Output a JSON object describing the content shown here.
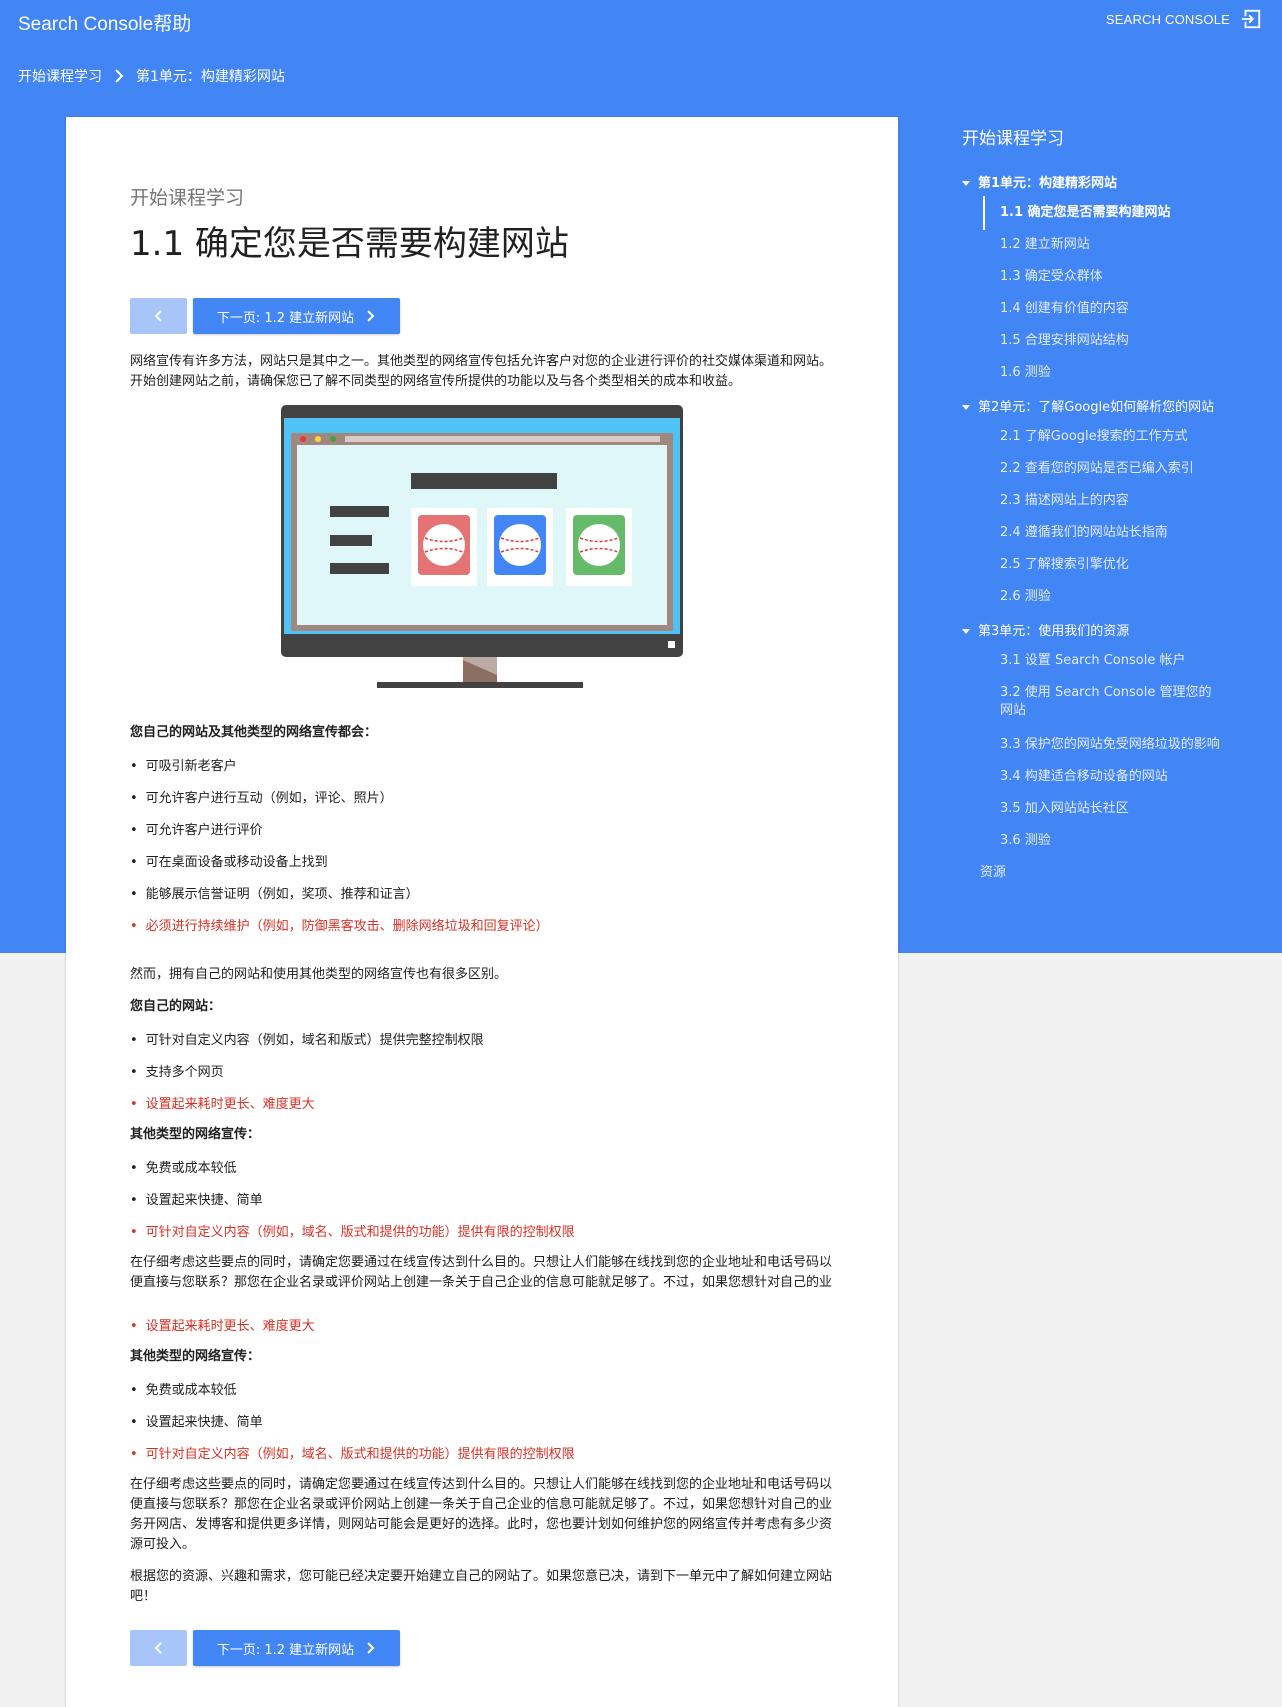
{
  "header": {
    "app_title": "Search Console帮助",
    "sc_link": "SEARCH CONSOLE"
  },
  "breadcrumb": {
    "root": "开始课程学习",
    "current": "第1单元：构建精彩网站"
  },
  "article": {
    "eyebrow": "开始课程学习",
    "title": "1.1 确定您是否需要构建网站",
    "next_label": "下一页: 1.2 建立新网站",
    "intro": "网络宣传有许多方法，网站只是其中之一。其他类型的网络宣传包括允许客户对您的企业进行评价的社交媒体渠道和网站。开始创建网站之前，请确保您已了解不同类型的网络宣传所提供的功能以及与各个类型相关的成本和收益。",
    "both_heading": "您自己的网站及其他类型的网络宣传都会：",
    "both_items": [
      "可吸引新老客户",
      "可允许客户进行互动（例如，评论、照片）",
      "可允许客户进行评价",
      "可在桌面设备或移动设备上找到",
      "能够展示信誉证明（例如，奖项、推荐和证言）"
    ],
    "both_warning": "必须进行持续维护（例如，防御黑客攻击、删除网络垃圾和回复评论）",
    "difference": "然而，拥有自己的网站和使用其他类型的网络宣传也有很多区别。",
    "own_heading": "您自己的网站：",
    "own_items": [
      "可针对自定义内容（例如，域名和版式）提供完整控制权限",
      "支持多个网页"
    ],
    "own_warning": "设置起来耗时更长、难度更大",
    "other_heading": "其他类型的网络宣传：",
    "other_items": [
      "免费或成本较低",
      "设置起来快捷、简单"
    ],
    "other_warning": "可针对自定义内容（例如，域名、版式和提供的功能）提供有限的控制权限",
    "consider": "在仔细考虑这些要点的同时，请确定您要通过在线宣传达到什么目的。只想让人们能够在线找到您的企业地址和电话号码以便直接与您联系？那您在企业名录或评价网站上创建一条关于自己企业的信息可能就足够了。不过，如果您想针对自己的业务开网店、发博客和提供更多详情，则网站可能会是更好的选择。此时，您也要计划如何维护您的网络宣传并考虑有多少资源可投入。",
    "closing": "根据您的资源、兴趣和需求，您可能已经决定要开始建立自己的网站了。如果您意已决，请到下一单元中了解如何建立网站吧！"
  },
  "toc": {
    "title": "开始课程学习",
    "unit1": "第1单元：构建精彩网站",
    "unit1_items": [
      "1.1 确定您是否需要构建网站",
      "1.2 建立新网站",
      "1.3 确定受众群体",
      "1.4 创建有价值的内容",
      "1.5 合理安排网站结构",
      "1.6 测验"
    ],
    "unit2": "第2单元：了解Google如何解析您的网站",
    "unit2_items": [
      "2.1 了解Google搜索的工作方式",
      "2.2 查看您的网站是否已编入索引",
      "2.3 描述网站上的内容",
      "2.4 遵循我们的网站站长指南",
      "2.5 了解搜索引擎优化",
      "2.6 测验"
    ],
    "unit3": "第3单元：使用我们的资源",
    "unit3_items": [
      "3.1 设置 Search Console 帐户",
      "3.2 使用 Search Console 管理您的网站",
      "3.3 保护您的网站免受网络垃圾的影响",
      "3.4 构建适合移动设备的网站",
      "3.5 加入网站站长社区",
      "3.6 测验"
    ],
    "resources": "资源"
  },
  "colors": {
    "brand": "#4285f4",
    "warning": "#d93025"
  }
}
